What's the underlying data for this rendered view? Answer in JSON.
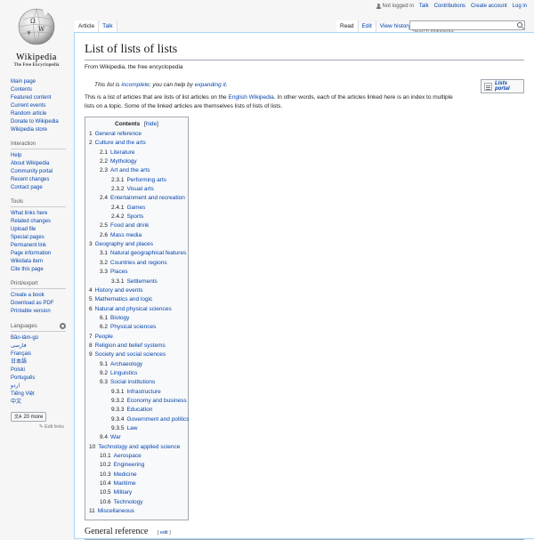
{
  "logo": {
    "wordmark": "Wikipedia",
    "tagline": "The Free Encyclopedia"
  },
  "sidebar": {
    "main": [
      "Main page",
      "Contents",
      "Featured content",
      "Current events",
      "Random article",
      "Donate to Wikipedia",
      "Wikipedia store"
    ],
    "interaction": {
      "title": "Interaction",
      "items": [
        "Help",
        "About Wikipedia",
        "Community portal",
        "Recent changes",
        "Contact page"
      ]
    },
    "tools": {
      "title": "Tools",
      "items": [
        "What links here",
        "Related changes",
        "Upload file",
        "Special pages",
        "Permanent link",
        "Page information",
        "Wikidata item",
        "Cite this page"
      ]
    },
    "print": {
      "title": "Print/export",
      "items": [
        "Create a book",
        "Download as PDF",
        "Printable version"
      ]
    },
    "languages": {
      "title": "Languages",
      "items": [
        "Bân-lâm-gú",
        "فارسی",
        "Français",
        "日本語",
        "Polski",
        "Português",
        "اردو",
        "Tiếng Việt",
        "中文"
      ],
      "more": "20 more",
      "edit_links": "Edit links"
    }
  },
  "personal": {
    "not_logged_in": "Not logged in",
    "talk": "Talk",
    "contributions": "Contributions",
    "create_account": "Create account",
    "login": "Log in"
  },
  "tabs": {
    "article": "Article",
    "talk": "Talk",
    "read": "Read",
    "edit": "Edit",
    "history": "View history"
  },
  "search": {
    "placeholder": "Search Wikipedia"
  },
  "page": {
    "title": "List of lists of lists",
    "site_sub": "From Wikipedia, the free encyclopedia",
    "hatnote": {
      "pre": "This list is ",
      "link1": "incomplete",
      "mid": "; you can help by ",
      "link2": "expanding it",
      "post": "."
    },
    "portal_label": "Lists portal",
    "intro": {
      "pre": "This is a list of articles that are lists of list articles on the ",
      "link": "English Wikipedia",
      "post": ". In other words, each of the articles linked here is an index to multiple lists on a topic. Some of the linked articles are themselves lists of lists of lists."
    }
  },
  "toc": {
    "title": "Contents",
    "toggle": "hide",
    "items": [
      {
        "num": "1",
        "text": "General reference",
        "level": 1
      },
      {
        "num": "2",
        "text": "Culture and the arts",
        "level": 1
      },
      {
        "num": "2.1",
        "text": "Literature",
        "level": 2
      },
      {
        "num": "2.2",
        "text": "Mythology",
        "level": 2
      },
      {
        "num": "2.3",
        "text": "Art and the arts",
        "level": 2
      },
      {
        "num": "2.3.1",
        "text": "Performing arts",
        "level": 3
      },
      {
        "num": "2.3.2",
        "text": "Visual arts",
        "level": 3
      },
      {
        "num": "2.4",
        "text": "Entertainment and recreation",
        "level": 2
      },
      {
        "num": "2.4.1",
        "text": "Games",
        "level": 3
      },
      {
        "num": "2.4.2",
        "text": "Sports",
        "level": 3
      },
      {
        "num": "2.5",
        "text": "Food and drink",
        "level": 2
      },
      {
        "num": "2.6",
        "text": "Mass media",
        "level": 2
      },
      {
        "num": "3",
        "text": "Geography and places",
        "level": 1
      },
      {
        "num": "3.1",
        "text": "Natural geographical features",
        "level": 2
      },
      {
        "num": "3.2",
        "text": "Countries and regions",
        "level": 2
      },
      {
        "num": "3.3",
        "text": "Places",
        "level": 2
      },
      {
        "num": "3.3.1",
        "text": "Settlements",
        "level": 3
      },
      {
        "num": "4",
        "text": "History and events",
        "level": 1
      },
      {
        "num": "5",
        "text": "Mathematics and logic",
        "level": 1
      },
      {
        "num": "6",
        "text": "Natural and physical sciences",
        "level": 1
      },
      {
        "num": "6.1",
        "text": "Biology",
        "level": 2
      },
      {
        "num": "6.2",
        "text": "Physical sciences",
        "level": 2
      },
      {
        "num": "7",
        "text": "People",
        "level": 1
      },
      {
        "num": "8",
        "text": "Religion and belief systems",
        "level": 1
      },
      {
        "num": "9",
        "text": "Society and social sciences",
        "level": 1
      },
      {
        "num": "9.1",
        "text": "Archaeology",
        "level": 2
      },
      {
        "num": "9.2",
        "text": "Linguistics",
        "level": 2
      },
      {
        "num": "9.3",
        "text": "Social institutions",
        "level": 2
      },
      {
        "num": "9.3.1",
        "text": "Infrastructure",
        "level": 3
      },
      {
        "num": "9.3.2",
        "text": "Economy and business",
        "level": 3
      },
      {
        "num": "9.3.3",
        "text": "Education",
        "level": 3
      },
      {
        "num": "9.3.4",
        "text": "Government and politics",
        "level": 3
      },
      {
        "num": "9.3.5",
        "text": "Law",
        "level": 3
      },
      {
        "num": "9.4",
        "text": "War",
        "level": 2
      },
      {
        "num": "10",
        "text": "Technology and applied science",
        "level": 1
      },
      {
        "num": "10.1",
        "text": "Aerospace",
        "level": 2
      },
      {
        "num": "10.2",
        "text": "Engineering",
        "level": 2
      },
      {
        "num": "10.3",
        "text": "Medicine",
        "level": 2
      },
      {
        "num": "10.4",
        "text": "Maritime",
        "level": 2
      },
      {
        "num": "10.5",
        "text": "Military",
        "level": 2
      },
      {
        "num": "10.6",
        "text": "Technology",
        "level": 2
      },
      {
        "num": "11",
        "text": "Miscellaneous",
        "level": 1
      }
    ]
  },
  "section": {
    "heading": "General reference",
    "edit": "edit"
  }
}
